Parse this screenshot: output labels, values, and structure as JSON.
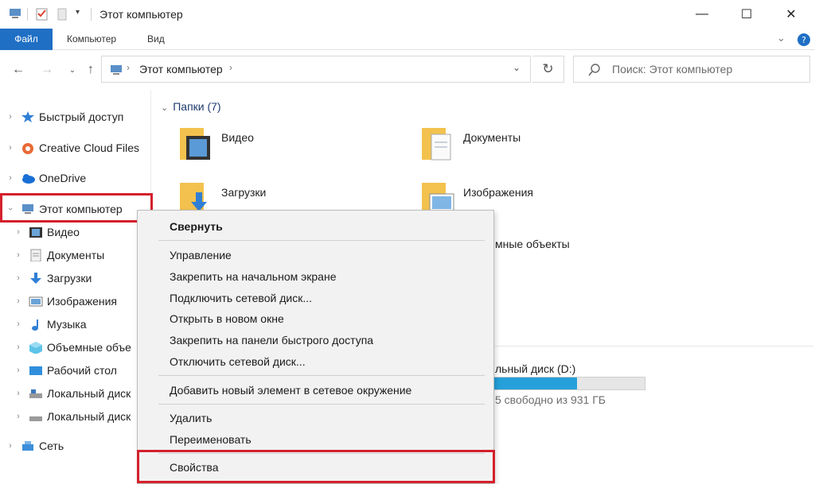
{
  "window": {
    "title": "Этот компьютер",
    "controls": {
      "minimize": "—",
      "maximize": "☐",
      "close": "✕"
    }
  },
  "ribbon": {
    "tabs": [
      {
        "label": "Файл"
      },
      {
        "label": "Компьютер"
      },
      {
        "label": "Вид"
      }
    ]
  },
  "address": {
    "path": "Этот компьютер",
    "search_placeholder": "Поиск: Этот компьютер"
  },
  "sidebar": {
    "items": [
      {
        "label": "Быстрый доступ",
        "icon": "star-icon"
      },
      {
        "label": "Creative Cloud Files",
        "icon": "creative-cloud-icon"
      },
      {
        "label": "OneDrive",
        "icon": "cloud-icon"
      },
      {
        "label": "Этот компьютер",
        "icon": "computer-icon"
      },
      {
        "label": "Видео",
        "icon": "video-icon"
      },
      {
        "label": "Документы",
        "icon": "document-icon"
      },
      {
        "label": "Загрузки",
        "icon": "download-icon"
      },
      {
        "label": "Изображения",
        "icon": "image-icon"
      },
      {
        "label": "Музыка",
        "icon": "music-icon"
      },
      {
        "label": "Объемные объе",
        "icon": "cube-icon"
      },
      {
        "label": "Рабочий стол",
        "icon": "desktop-icon"
      },
      {
        "label": "Локальный диск",
        "icon": "drive-icon"
      },
      {
        "label": "Локальный диск",
        "icon": "drive-icon"
      },
      {
        "label": "Сеть",
        "icon": "network-icon"
      }
    ]
  },
  "content": {
    "group_title": "Папки (7)",
    "folders": [
      {
        "label": "Видео"
      },
      {
        "label": "Документы"
      },
      {
        "label": "Загрузки"
      },
      {
        "label": "Изображения"
      }
    ],
    "peek_objects": "мные объекты",
    "peek_disk": "льный диск (D:)",
    "peek_free": "5 свободно из 931 ГБ",
    "disk_usage_fraction": 0.55
  },
  "context_menu": {
    "items": [
      {
        "label": "Свернуть",
        "bold": true
      },
      {
        "label": "Управление"
      },
      {
        "label": "Закрепить на начальном экране"
      },
      {
        "label": "Подключить сетевой диск..."
      },
      {
        "label": "Открыть в новом окне"
      },
      {
        "label": "Закрепить на панели быстрого доступа"
      },
      {
        "label": "Отключить сетевой диск..."
      },
      {
        "label": "Добавить новый элемент в сетевое окружение"
      },
      {
        "label": "Удалить"
      },
      {
        "label": "Переименовать"
      },
      {
        "label": "Свойства"
      }
    ]
  },
  "colors": {
    "accent": "#1f6fc5",
    "highlight": "#d4202c",
    "folder": "#f3c24e",
    "disk_fill": "#26a0da"
  }
}
